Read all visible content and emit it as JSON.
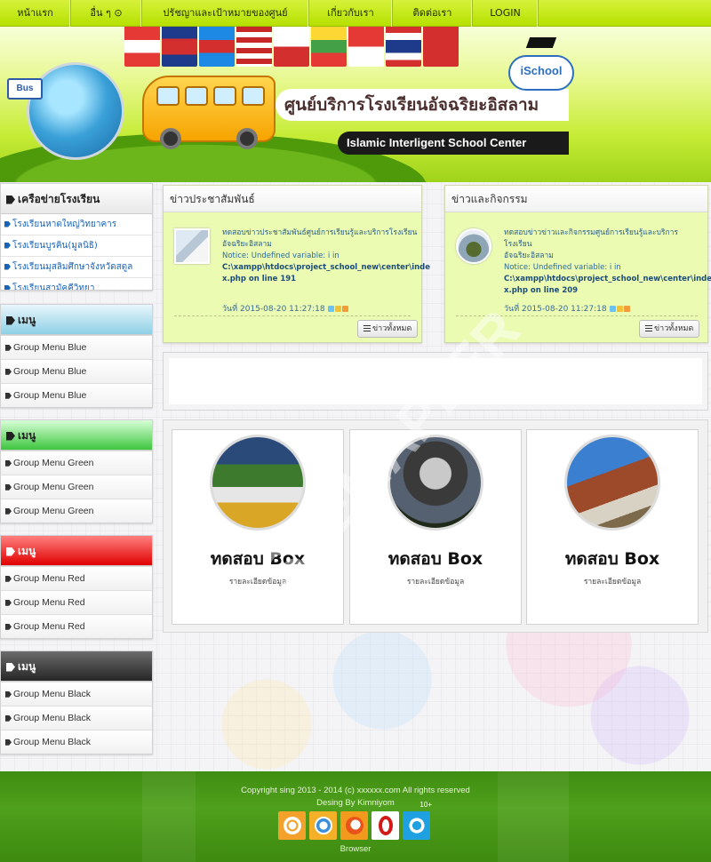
{
  "nav": {
    "items": [
      {
        "label": "หน้าแรก"
      },
      {
        "label": "อื่น ๆ ⊙"
      },
      {
        "label": "ปรัชญาและเป้าหมายของศูนย์"
      },
      {
        "label": "เกี่ยวกับเรา"
      },
      {
        "label": "ติดต่อเรา"
      },
      {
        "label": "LOGIN"
      }
    ]
  },
  "banner": {
    "title_th": "ศูนย์บริการโรงเรียนอัจฉริยะอิสลาม",
    "title_en": "Islamic Interligent School Center",
    "logo_text": "iSchool",
    "bus_sign": "Bus"
  },
  "sidebar": {
    "network": {
      "title": "เครือข่ายโรงเรียน",
      "items": [
        "โรงเรียนหาดใหญ่วิทยาคาร",
        "โรงเรียนบูรคิน(มูลนิธิ)",
        "โรงเรียนมุสลิมศึกษาจังหวัดสตูล",
        "โรงเรียนสามัคคีวิทยา"
      ]
    },
    "menus": [
      {
        "title": "เมนู",
        "items": [
          "Group Menu Blue",
          "Group Menu Blue",
          "Group Menu Blue"
        ]
      },
      {
        "title": "เมนู",
        "items": [
          "Group Menu Green",
          "Group Menu Green",
          "Group Menu Green"
        ]
      },
      {
        "title": "เมนู",
        "items": [
          "Group Menu Red",
          "Group Menu Red",
          "Group Menu Red"
        ]
      },
      {
        "title": "เมนู",
        "items": [
          "Group Menu Black",
          "Group Menu Black",
          "Group Menu Black"
        ]
      }
    ]
  },
  "news": [
    {
      "title": "ข่าวประชาสัมพันธ์",
      "line1": "ทดสอบข่าวประชาสัมพันธ์ศูนย์การเรียนรู้และบริการโรงเรียน",
      "line2": "อัจฉริยะอิสลาม",
      "notice": "Notice: Undefined variable: i in",
      "path1": "C:\\xampp\\htdocs\\project_school_new\\center\\inde",
      "path2": "x.php on line 191",
      "date": "วันที่ 2015-08-20 11:27:18",
      "button": "ข่าวทั้งหมด"
    },
    {
      "title": "ข่าวและกิจกรรม",
      "line1": "ทดสอบข่าวข่าวและกิจกรรมศูนย์การเรียนรู้และบริการโรงเรียน",
      "line2": "อัจฉริยะอิสลาม",
      "notice": "Notice: Undefined variable: i in",
      "path1": "C:\\xampp\\htdocs\\project_school_new\\center\\inde",
      "path2": "x.php on line 209",
      "date": "วันที่ 2015-08-20 11:27:18",
      "button": "ข่าวทั้งหมด"
    }
  ],
  "boxes": [
    {
      "title": "ทดสอบ Box",
      "desc": "รายละเอียดข้อมูล"
    },
    {
      "title": "ทดสอบ Box",
      "desc": "รายละเอียดข้อมูล"
    },
    {
      "title": "ทดสอบ Box",
      "desc": "รายละเอียดข้อมูล"
    }
  ],
  "footer": {
    "copyright": "Copyright sing 2013 - 2014 (c) xxxxxx.com All rights reserved",
    "design": "Desing By Kimniyom",
    "browsers_label": "Browser",
    "ie_version": "10+",
    "browser_icons": [
      "chrome-icon",
      "safari-icon",
      "firefox-icon",
      "opera-icon",
      "ie-icon"
    ]
  },
  "watermark": "SSEMAPLER",
  "colors": {
    "nav": "#c4ea14",
    "news_bg": "#ebfbb2",
    "footer": "#4a9a18",
    "link": "#1a64b8"
  }
}
